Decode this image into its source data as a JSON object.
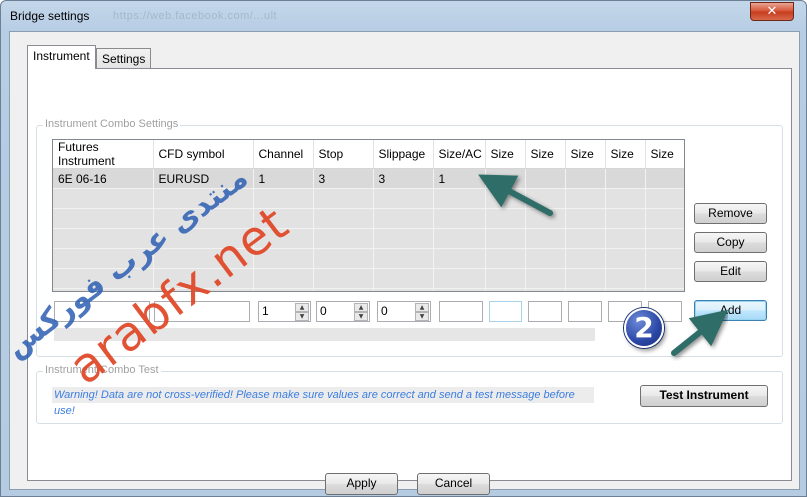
{
  "window": {
    "title": "Bridge settings",
    "watermark_url": "https://web.facebook.com/...ult",
    "close_glyph": "✕"
  },
  "tabs": [
    {
      "label": "Instrument",
      "active": true
    },
    {
      "label": "Settings",
      "active": false
    }
  ],
  "combo_settings": {
    "group_label": "Instrument Combo Settings",
    "columns": [
      "Futures Instrument",
      "CFD symbol",
      "Channel",
      "Stop",
      "Slippage",
      "Size/AC",
      "Size",
      "Size",
      "Size",
      "Size",
      "Size"
    ],
    "rows": [
      [
        "6E 06-16",
        "EURUSD",
        "1",
        "3",
        "3",
        "1",
        "",
        "",
        "",
        "",
        ""
      ]
    ],
    "editor": {
      "channel_value": "1",
      "stop_value": "0",
      "slippage_value": "0"
    },
    "buttons": {
      "remove": "Remove",
      "copy": "Copy",
      "edit": "Edit",
      "add": "Add"
    }
  },
  "combo_test": {
    "group_label": "Instrument Combo Test",
    "warning": "Warning!  Data are not cross-verified!  Please make sure values are correct and send a test message before use!",
    "test_button": "Test Instrument"
  },
  "footer": {
    "apply": "Apply",
    "cancel": "Cancel"
  },
  "overlay": {
    "badge_number": "2",
    "watermark_latin": "arabfx.net",
    "watermark_arabic": "منتدى عرب فوركس"
  },
  "colors": {
    "title_bar": "#b7cde4",
    "close_button": "#c73d1f",
    "warning_text": "#3b7de0",
    "annotation_arrow": "#2e6d68",
    "watermark_red": "#e04a2a",
    "watermark_blue": "#2c5fb3"
  }
}
